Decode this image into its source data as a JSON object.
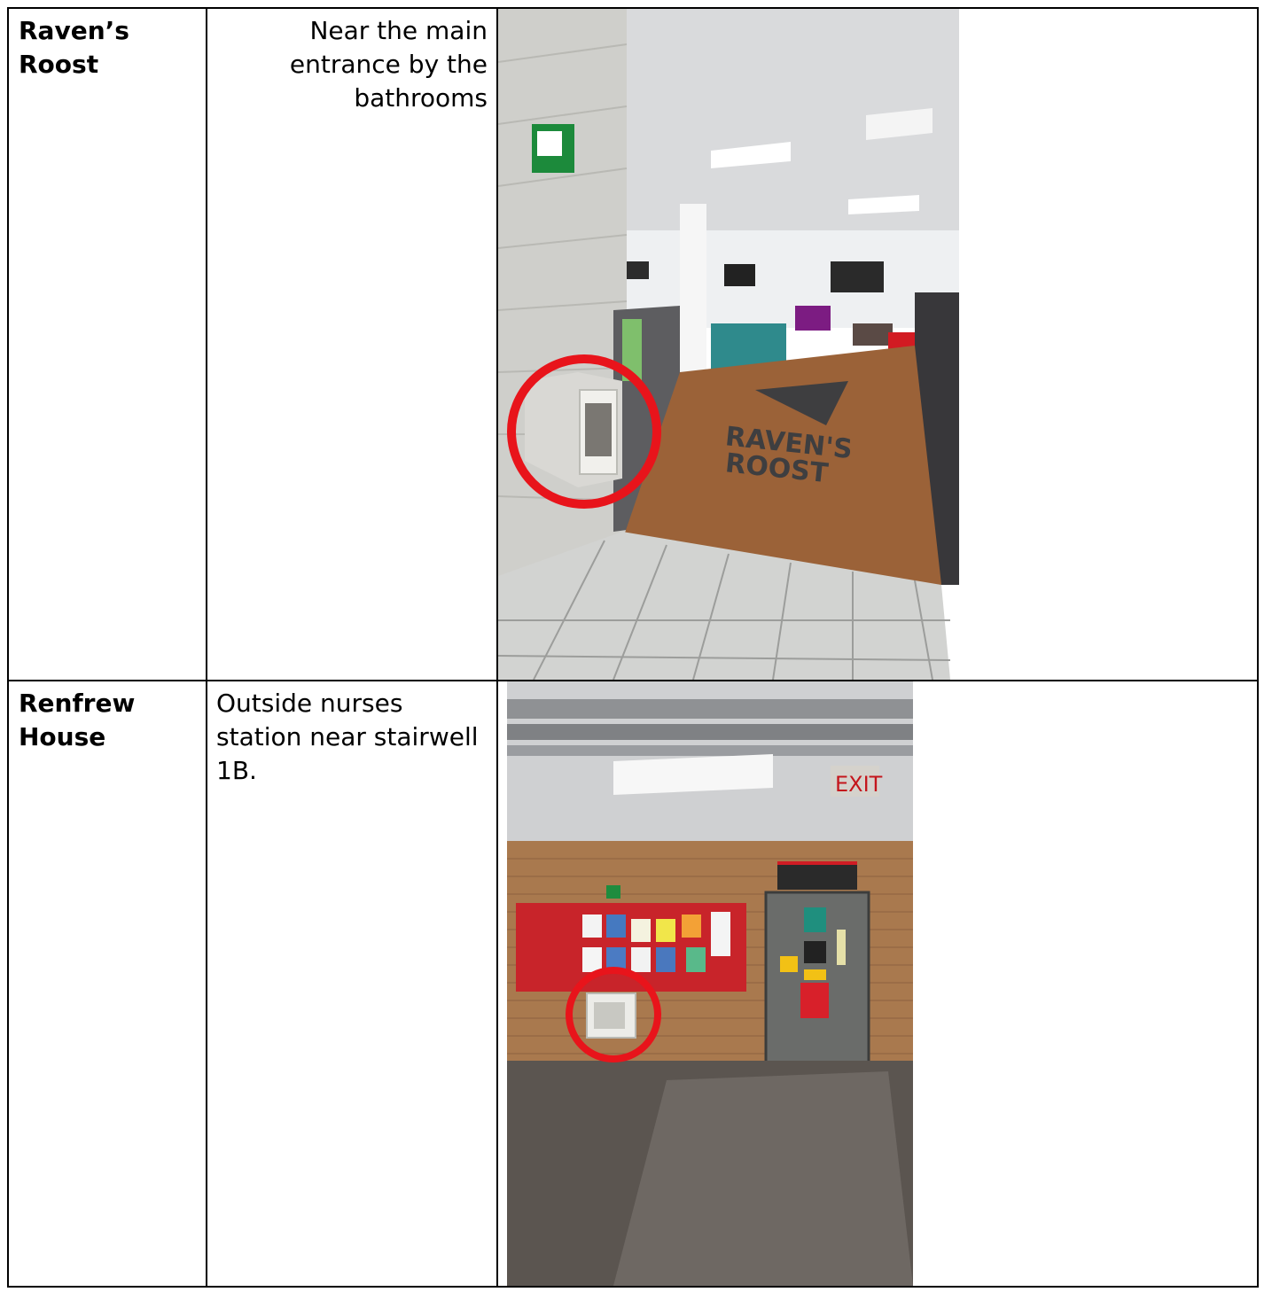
{
  "rows": [
    {
      "building": "Raven’s Roost",
      "location": "Near the main entrance by the bathrooms",
      "photo": {
        "icon": "aed-location-photo",
        "circle_color": "#e8141b"
      }
    },
    {
      "building": "Renfrew House",
      "location": "Outside nurses station near stairwell 1B.",
      "photo": {
        "icon": "aed-location-photo",
        "circle_color": "#e8141b"
      }
    }
  ]
}
